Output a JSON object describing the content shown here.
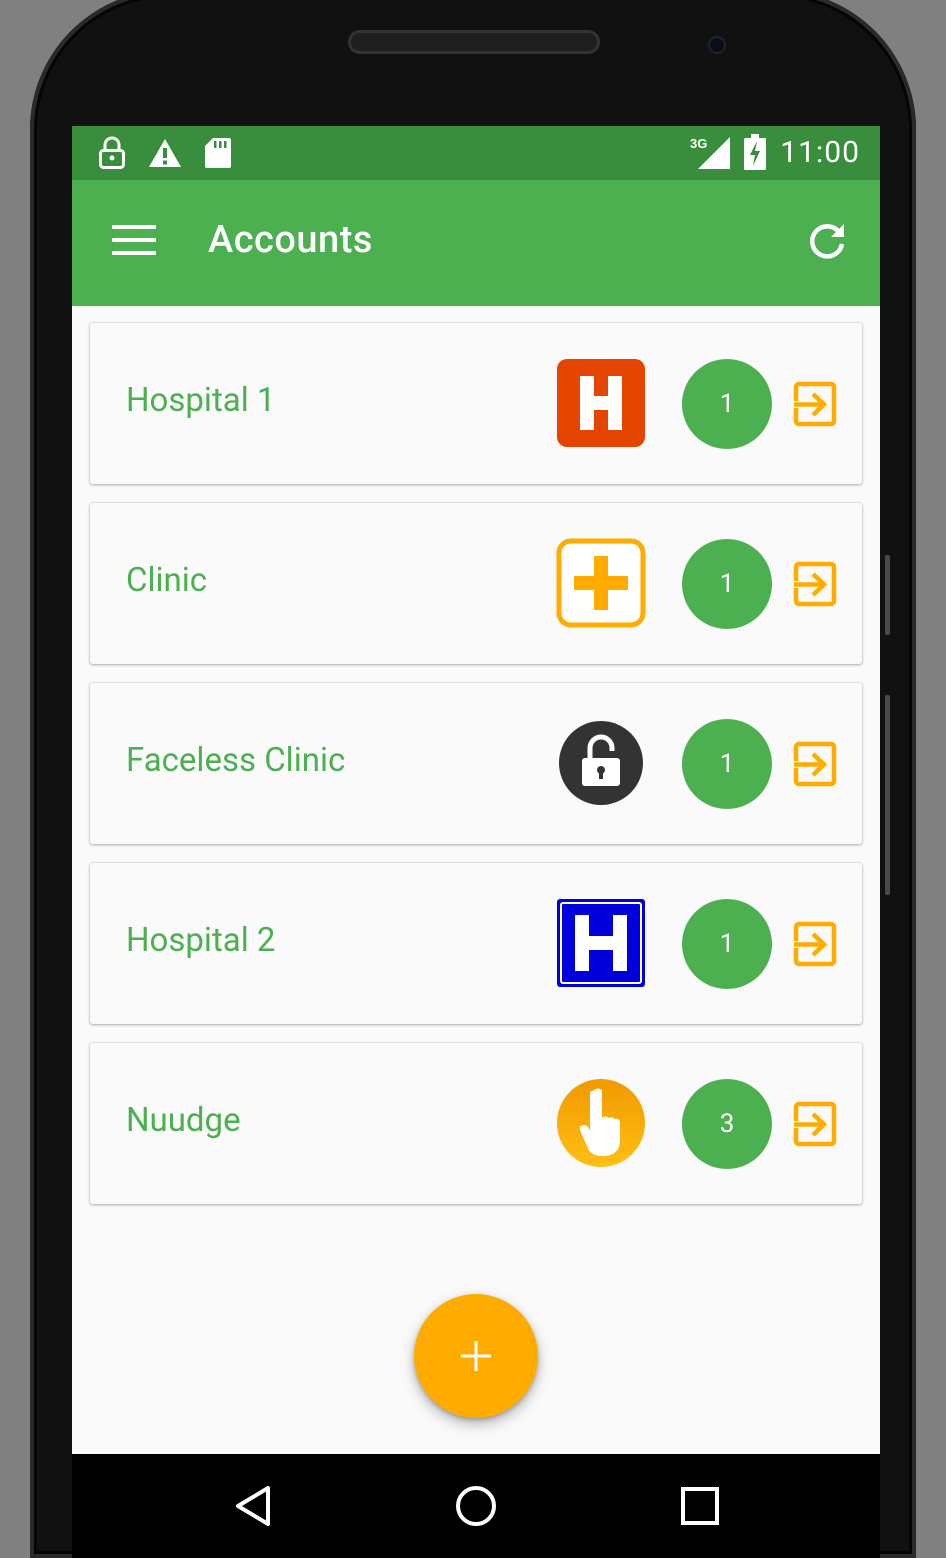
{
  "status_bar": {
    "time": "11:00",
    "network": "3G",
    "left_icons": [
      "lock-icon",
      "warning-icon",
      "sd-card-icon"
    ],
    "right_icons": [
      "signal-icon",
      "battery-charging-icon"
    ]
  },
  "app_bar": {
    "title": "Accounts",
    "menu_icon": "hamburger-menu-icon",
    "action_icon": "refresh-icon",
    "color": "#4caf50",
    "status_color": "#388e3c"
  },
  "accounts": [
    {
      "name": "Hospital 1",
      "icon": "hospital-h-orange-icon",
      "count": "1"
    },
    {
      "name": "Clinic",
      "icon": "clinic-plus-icon",
      "count": "1"
    },
    {
      "name": "Faceless Clinic",
      "icon": "unlocked-padlock-icon",
      "count": "1"
    },
    {
      "name": "Hospital 2",
      "icon": "hospital-h-blue-icon",
      "count": "1"
    },
    {
      "name": "Nuudge",
      "icon": "pointing-hand-icon",
      "count": "3"
    }
  ],
  "fab": {
    "icon": "plus-icon",
    "color": "#ffab00"
  },
  "nav_bar": {
    "buttons": [
      "back-icon",
      "home-icon",
      "recents-icon"
    ]
  },
  "colors": {
    "accent": "#ffab00",
    "name_text": "#4caf50",
    "badge": "#4caf50"
  }
}
